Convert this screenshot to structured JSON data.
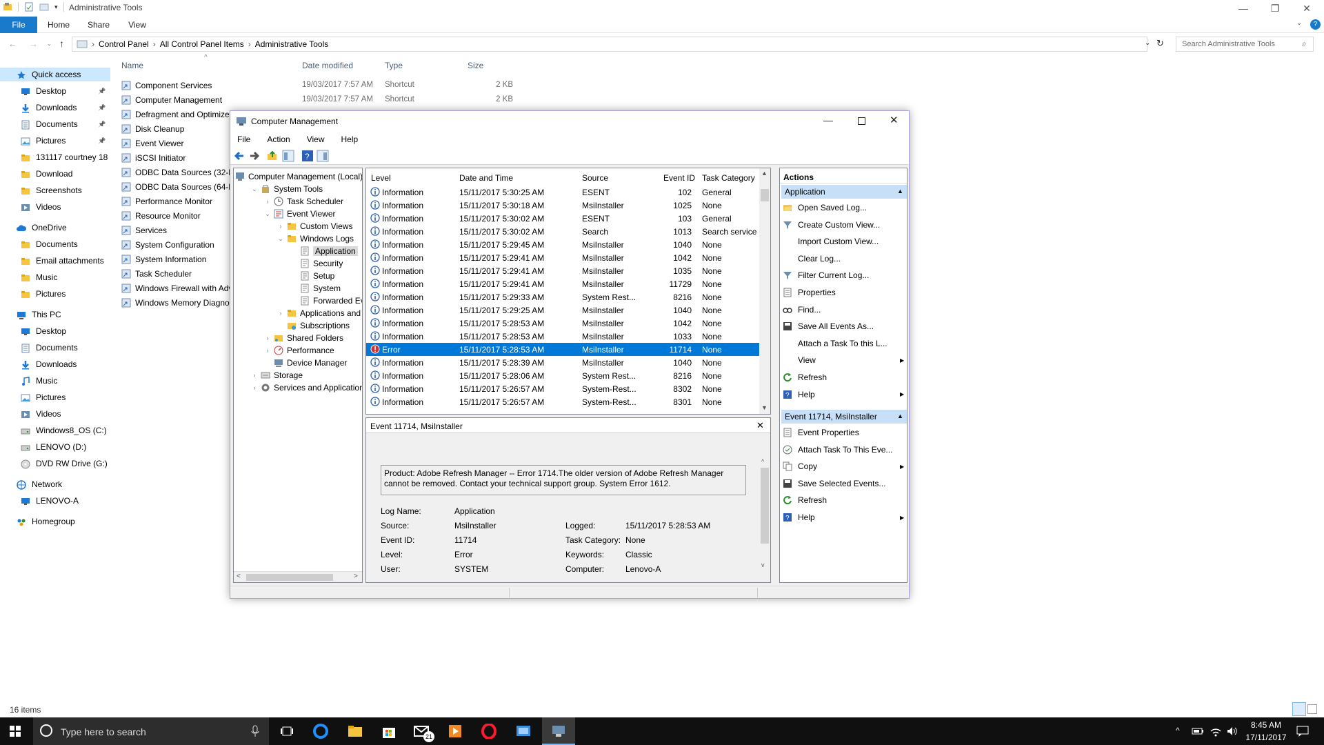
{
  "explorer": {
    "title": "Administrative Tools",
    "ribbon_tabs": [
      "File",
      "Home",
      "Share",
      "View"
    ],
    "breadcrumb": [
      "Control Panel",
      "All Control Panel Items",
      "Administrative Tools"
    ],
    "search_placeholder": "Search Administrative Tools",
    "columns": [
      "Name",
      "Date modified",
      "Type",
      "Size"
    ],
    "files": [
      {
        "name": "Component Services",
        "date": "19/03/2017 7:57 AM",
        "type": "Shortcut",
        "size": "2 KB"
      },
      {
        "name": "Computer Management",
        "date": "19/03/2017 7:57 AM",
        "type": "Shortcut",
        "size": "2 KB"
      },
      {
        "name": "Defragment and Optimize Drives",
        "date": "",
        "type": "",
        "size": ""
      },
      {
        "name": "Disk Cleanup",
        "date": "",
        "type": "",
        "size": ""
      },
      {
        "name": "Event Viewer",
        "date": "",
        "type": "",
        "size": ""
      },
      {
        "name": "iSCSI Initiator",
        "date": "",
        "type": "",
        "size": ""
      },
      {
        "name": "ODBC Data Sources (32-bit)",
        "date": "",
        "type": "",
        "size": ""
      },
      {
        "name": "ODBC Data Sources (64-bit)",
        "date": "",
        "type": "",
        "size": ""
      },
      {
        "name": "Performance Monitor",
        "date": "",
        "type": "",
        "size": ""
      },
      {
        "name": "Resource Monitor",
        "date": "",
        "type": "",
        "size": ""
      },
      {
        "name": "Services",
        "date": "",
        "type": "",
        "size": ""
      },
      {
        "name": "System Configuration",
        "date": "",
        "type": "",
        "size": ""
      },
      {
        "name": "System Information",
        "date": "",
        "type": "",
        "size": ""
      },
      {
        "name": "Task Scheduler",
        "date": "",
        "type": "",
        "size": ""
      },
      {
        "name": "Windows Firewall with Advanced Security",
        "date": "",
        "type": "",
        "size": ""
      },
      {
        "name": "Windows Memory Diagnostic",
        "date": "",
        "type": "",
        "size": ""
      }
    ],
    "status": "16 items",
    "nav": [
      {
        "label": "Quick access",
        "icon": "star-icon",
        "color": "#1e78d6",
        "sel": true,
        "indent": 0
      },
      {
        "label": "Desktop",
        "icon": "desktop-icon",
        "color": "#1e78d6",
        "pin": true,
        "indent": 1
      },
      {
        "label": "Downloads",
        "icon": "download-icon",
        "color": "#1e78d6",
        "pin": true,
        "indent": 1
      },
      {
        "label": "Documents",
        "icon": "documents-icon",
        "color": "#6b8db0",
        "pin": true,
        "indent": 1
      },
      {
        "label": "Pictures",
        "icon": "pictures-icon",
        "color": "#6b8db0",
        "pin": true,
        "indent": 1
      },
      {
        "label": "131117 courtney 18",
        "icon": "folder-icon",
        "color": "#f5c542",
        "indent": 1
      },
      {
        "label": "Download",
        "icon": "folder-icon",
        "color": "#f5c542",
        "indent": 1
      },
      {
        "label": "Screenshots",
        "icon": "folder-icon",
        "color": "#f5c542",
        "indent": 1
      },
      {
        "label": "Videos",
        "icon": "videos-icon",
        "color": "#6b8db0",
        "indent": 1
      },
      {
        "label": "",
        "gap": true
      },
      {
        "label": "OneDrive",
        "icon": "cloud-icon",
        "color": "#1e78d6",
        "indent": 0
      },
      {
        "label": "Documents",
        "icon": "folder-icon",
        "color": "#f5c542",
        "indent": 1
      },
      {
        "label": "Email attachments",
        "icon": "folder-icon",
        "color": "#f5c542",
        "indent": 1
      },
      {
        "label": "Music",
        "icon": "folder-icon",
        "color": "#f5c542",
        "indent": 1
      },
      {
        "label": "Pictures",
        "icon": "folder-icon",
        "color": "#f5c542",
        "indent": 1
      },
      {
        "label": "",
        "gap": true
      },
      {
        "label": "This PC",
        "icon": "pc-icon",
        "color": "#1e78d6",
        "indent": 0
      },
      {
        "label": "Desktop",
        "icon": "desktop-icon",
        "color": "#1e78d6",
        "indent": 1
      },
      {
        "label": "Documents",
        "icon": "documents-icon",
        "color": "#6b8db0",
        "indent": 1
      },
      {
        "label": "Downloads",
        "icon": "download-icon",
        "color": "#1e78d6",
        "indent": 1
      },
      {
        "label": "Music",
        "icon": "music-icon",
        "color": "#1e78d6",
        "indent": 1
      },
      {
        "label": "Pictures",
        "icon": "pictures-icon",
        "color": "#6b8db0",
        "indent": 1
      },
      {
        "label": "Videos",
        "icon": "videos-icon",
        "color": "#6b8db0",
        "indent": 1
      },
      {
        "label": "Windows8_OS (C:)",
        "icon": "drive-icon",
        "color": "#888888",
        "indent": 1
      },
      {
        "label": "LENOVO (D:)",
        "icon": "drive-icon",
        "color": "#888888",
        "indent": 1
      },
      {
        "label": "DVD RW Drive (G:) 1",
        "icon": "dvd-icon",
        "color": "#888888",
        "indent": 1
      },
      {
        "label": "",
        "gap": true
      },
      {
        "label": "Network",
        "icon": "network-icon",
        "color": "#1e78d6",
        "indent": 0
      },
      {
        "label": "LENOVO-A",
        "icon": "desktop-icon",
        "color": "#1e78d6",
        "indent": 1
      },
      {
        "label": "",
        "gap": true
      },
      {
        "label": "Homegroup",
        "icon": "homegroup-icon",
        "color": "#1e78d6",
        "indent": 0
      }
    ]
  },
  "cm": {
    "title": "Computer Management",
    "menu": [
      "File",
      "Action",
      "View",
      "Help"
    ],
    "tree": [
      {
        "label": "Computer Management (Local)",
        "level": 0,
        "exp": "",
        "icon": "computer-icon"
      },
      {
        "label": "System Tools",
        "level": 1,
        "exp": "v",
        "icon": "tools-icon"
      },
      {
        "label": "Task Scheduler",
        "level": 2,
        "exp": ">",
        "icon": "clock-icon"
      },
      {
        "label": "Event Viewer",
        "level": 2,
        "exp": "v",
        "icon": "event-viewer-icon"
      },
      {
        "label": "Custom Views",
        "level": 3,
        "exp": ">",
        "icon": "folder-icon"
      },
      {
        "label": "Windows Logs",
        "level": 3,
        "exp": "v",
        "icon": "folder-icon"
      },
      {
        "label": "Application",
        "level": 4,
        "exp": "",
        "icon": "log-icon",
        "sel": true
      },
      {
        "label": "Security",
        "level": 4,
        "exp": "",
        "icon": "log-icon"
      },
      {
        "label": "Setup",
        "level": 4,
        "exp": "",
        "icon": "log-icon"
      },
      {
        "label": "System",
        "level": 4,
        "exp": "",
        "icon": "log-icon"
      },
      {
        "label": "Forwarded Events",
        "level": 4,
        "exp": "",
        "icon": "log-icon"
      },
      {
        "label": "Applications and Services Logs",
        "level": 3,
        "exp": ">",
        "icon": "folder-icon"
      },
      {
        "label": "Subscriptions",
        "level": 3,
        "exp": "",
        "icon": "subscriptions-icon"
      },
      {
        "label": "Shared Folders",
        "level": 2,
        "exp": ">",
        "icon": "shared-folder-icon"
      },
      {
        "label": "Performance",
        "level": 2,
        "exp": ">",
        "icon": "performance-icon"
      },
      {
        "label": "Device Manager",
        "level": 2,
        "exp": "",
        "icon": "device-manager-icon"
      },
      {
        "label": "Storage",
        "level": 1,
        "exp": ">",
        "icon": "storage-icon"
      },
      {
        "label": "Services and Applications",
        "level": 1,
        "exp": ">",
        "icon": "services-icon"
      }
    ],
    "event_columns": [
      "Level",
      "Date and Time",
      "Source",
      "Event ID",
      "Task Category"
    ],
    "events": [
      {
        "level": "Information",
        "date": "15/11/2017 5:30:25 AM",
        "source": "ESENT",
        "id": "102",
        "cat": "General"
      },
      {
        "level": "Information",
        "date": "15/11/2017 5:30:18 AM",
        "source": "MsiInstaller",
        "id": "1025",
        "cat": "None"
      },
      {
        "level": "Information",
        "date": "15/11/2017 5:30:02 AM",
        "source": "ESENT",
        "id": "103",
        "cat": "General"
      },
      {
        "level": "Information",
        "date": "15/11/2017 5:30:02 AM",
        "source": "Search",
        "id": "1013",
        "cat": "Search service"
      },
      {
        "level": "Information",
        "date": "15/11/2017 5:29:45 AM",
        "source": "MsiInstaller",
        "id": "1040",
        "cat": "None"
      },
      {
        "level": "Information",
        "date": "15/11/2017 5:29:41 AM",
        "source": "MsiInstaller",
        "id": "1042",
        "cat": "None"
      },
      {
        "level": "Information",
        "date": "15/11/2017 5:29:41 AM",
        "source": "MsiInstaller",
        "id": "1035",
        "cat": "None"
      },
      {
        "level": "Information",
        "date": "15/11/2017 5:29:41 AM",
        "source": "MsiInstaller",
        "id": "11729",
        "cat": "None"
      },
      {
        "level": "Information",
        "date": "15/11/2017 5:29:33 AM",
        "source": "System Rest...",
        "id": "8216",
        "cat": "None"
      },
      {
        "level": "Information",
        "date": "15/11/2017 5:29:25 AM",
        "source": "MsiInstaller",
        "id": "1040",
        "cat": "None"
      },
      {
        "level": "Information",
        "date": "15/11/2017 5:28:53 AM",
        "source": "MsiInstaller",
        "id": "1042",
        "cat": "None"
      },
      {
        "level": "Information",
        "date": "15/11/2017 5:28:53 AM",
        "source": "MsiInstaller",
        "id": "1033",
        "cat": "None"
      },
      {
        "level": "Error",
        "date": "15/11/2017 5:28:53 AM",
        "source": "MsiInstaller",
        "id": "11714",
        "cat": "None",
        "sel": true
      },
      {
        "level": "Information",
        "date": "15/11/2017 5:28:39 AM",
        "source": "MsiInstaller",
        "id": "1040",
        "cat": "None"
      },
      {
        "level": "Information",
        "date": "15/11/2017 5:28:06 AM",
        "source": "System Rest...",
        "id": "8216",
        "cat": "None"
      },
      {
        "level": "Information",
        "date": "15/11/2017 5:26:57 AM",
        "source": "System-Rest...",
        "id": "8302",
        "cat": "None"
      },
      {
        "level": "Information",
        "date": "15/11/2017 5:26:57 AM",
        "source": "System-Rest...",
        "id": "8301",
        "cat": "None"
      }
    ],
    "detail": {
      "title": "Event 11714, MsiInstaller",
      "message": "Product: Adobe Refresh Manager -- Error 1714.The older version of Adobe Refresh Manager cannot be removed.  Contact your technical support group.  System Error 1612.",
      "fields_left": [
        {
          "k": "Log Name:",
          "v": "Application"
        },
        {
          "k": "Source:",
          "v": "MsiInstaller"
        },
        {
          "k": "Event ID:",
          "v": "11714"
        },
        {
          "k": "Level:",
          "v": "Error"
        },
        {
          "k": "User:",
          "v": "SYSTEM"
        }
      ],
      "fields_right": [
        {
          "k": "Logged:",
          "v": "15/11/2017 5:28:53 AM"
        },
        {
          "k": "Task Category:",
          "v": "None"
        },
        {
          "k": "Keywords:",
          "v": "Classic"
        },
        {
          "k": "Computer:",
          "v": "Lenovo-A"
        }
      ]
    },
    "actions_title": "Actions",
    "section1": "Application",
    "actions1": [
      {
        "label": "Open Saved Log...",
        "icon": "open-folder-icon"
      },
      {
        "label": "Create Custom View...",
        "icon": "filter-icon"
      },
      {
        "label": "Import Custom View...",
        "icon": ""
      },
      {
        "label": "Clear Log...",
        "icon": ""
      },
      {
        "label": "Filter Current Log...",
        "icon": "filter-icon"
      },
      {
        "label": "Properties",
        "icon": "properties-icon"
      },
      {
        "label": "Find...",
        "icon": "find-icon"
      },
      {
        "label": "Save All Events As...",
        "icon": "save-icon"
      },
      {
        "label": "Attach a Task To this L...",
        "icon": ""
      },
      {
        "label": "View",
        "icon": "",
        "sub": true
      },
      {
        "label": "Refresh",
        "icon": "refresh-icon"
      },
      {
        "label": "Help",
        "icon": "help-icon",
        "sub": true
      }
    ],
    "section2": "Event 11714, MsiInstaller",
    "actions2": [
      {
        "label": "Event Properties",
        "icon": "properties-icon"
      },
      {
        "label": "Attach Task To This Eve...",
        "icon": "task-icon"
      },
      {
        "label": "Copy",
        "icon": "copy-icon",
        "sub": true
      },
      {
        "label": "Save Selected Events...",
        "icon": "save-icon"
      },
      {
        "label": "Refresh",
        "icon": "refresh-icon"
      },
      {
        "label": "Help",
        "icon": "help-icon",
        "sub": true
      }
    ]
  },
  "taskbar": {
    "search_placeholder": "Type here to search",
    "mail_badge": "21",
    "time": "8:45 AM",
    "date": "17/11/2017"
  }
}
